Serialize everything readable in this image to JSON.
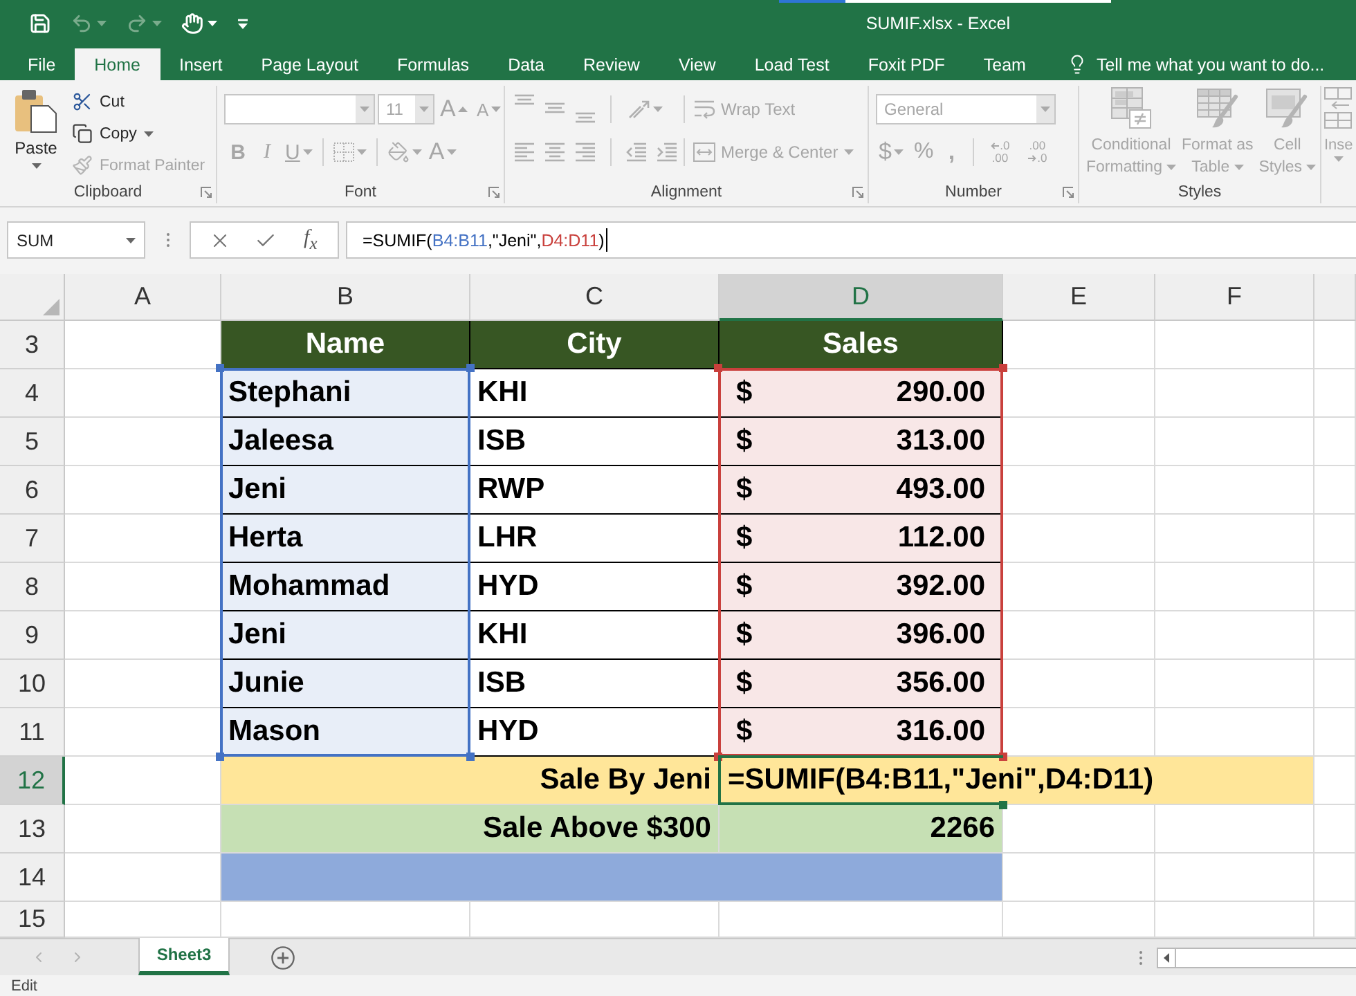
{
  "window": {
    "title": "SUMIF.xlsx - Excel",
    "progress": {
      "level": 0.2
    }
  },
  "quick_access": [
    {
      "kind": "save",
      "disabled": false
    },
    {
      "kind": "undo",
      "disabled": true
    },
    {
      "kind": "redo",
      "disabled": true
    },
    {
      "kind": "touch",
      "disabled": false
    },
    {
      "kind": "customize",
      "disabled": false
    }
  ],
  "ribbon_tabs": [
    {
      "label": "File",
      "selected": false
    },
    {
      "label": "Home",
      "selected": true
    },
    {
      "label": "Insert",
      "selected": false
    },
    {
      "label": "Page Layout",
      "selected": false
    },
    {
      "label": "Formulas",
      "selected": false
    },
    {
      "label": "Data",
      "selected": false
    },
    {
      "label": "Review",
      "selected": false
    },
    {
      "label": "View",
      "selected": false
    },
    {
      "label": "Load Test",
      "selected": false
    },
    {
      "label": "Foxit PDF",
      "selected": false
    },
    {
      "label": "Team",
      "selected": false
    }
  ],
  "tell_me": "Tell me what you want to do...",
  "ribbon": {
    "clipboard": {
      "label": "Clipboard",
      "paste": {
        "label": "Paste",
        "disabled": false
      },
      "items": [
        {
          "kind": "cut",
          "label": "Cut",
          "disabled": false
        },
        {
          "kind": "copy",
          "label": "Copy",
          "disabled": false
        },
        {
          "kind": "format_painter",
          "label": "Format Painter",
          "disabled": true
        }
      ]
    },
    "font": {
      "label": "Font",
      "disabled": true,
      "font_size": "11",
      "size_buttons": [
        {
          "kind": "grow",
          "label": "A"
        },
        {
          "kind": "shrink",
          "label": "A"
        }
      ],
      "style_buttons": [
        {
          "kind": "bold",
          "label": "B"
        },
        {
          "kind": "italic",
          "label": "I"
        },
        {
          "kind": "underline",
          "label": "U"
        }
      ],
      "font_color": "A"
    },
    "alignment": {
      "label": "Alignment",
      "disabled": true,
      "wrap_text": "Wrap Text",
      "merge_center": "Merge & Center"
    },
    "number": {
      "label": "Number",
      "disabled": true,
      "format": "General",
      "buttons": [
        {
          "kind": "currency",
          "label": "$"
        },
        {
          "kind": "percent",
          "label": "%"
        },
        {
          "kind": "comma",
          "label": ","
        }
      ],
      "decimals": [
        {
          "kind": "increase",
          "lines": [
            ".0",
            ".00"
          ]
        },
        {
          "kind": "decrease",
          "lines": [
            ".00",
            ".0"
          ]
        }
      ]
    },
    "styles": {
      "label": "Styles",
      "disabled": true,
      "buttons": [
        {
          "kind": "conditional",
          "lines": [
            "Conditional",
            "Formatting"
          ]
        },
        {
          "kind": "table",
          "lines": [
            "Format as",
            "Table"
          ]
        },
        {
          "kind": "cell_styles",
          "lines": [
            "Cell",
            "Styles"
          ]
        }
      ]
    },
    "cells": {
      "disabled": true,
      "insert": "Inse"
    }
  },
  "name_box": "SUM",
  "function_button": "f$_{x}$",
  "formula_bar": {
    "parts": [
      {
        "text": "=SUMIF(",
        "color": "#000000"
      },
      {
        "text": "B4:B11",
        "color": "#4472c4"
      },
      {
        "text": ",\"Jeni\",",
        "color": "#000000"
      },
      {
        "text": "D4:D11",
        "color": "#c9403c"
      },
      {
        "text": ")",
        "color": "#000000"
      }
    ]
  },
  "sheet": {
    "columns": [
      {
        "label": "A",
        "selected": false
      },
      {
        "label": "B",
        "selected": false
      },
      {
        "label": "C",
        "selected": false
      },
      {
        "label": "D",
        "selected": true
      },
      {
        "label": "E",
        "selected": false
      },
      {
        "label": "F",
        "selected": false
      }
    ],
    "reference_ranges": [
      {
        "kind": "name",
        "color": "#4472c4",
        "fill": {
          "color": "#e8eef8"
        }
      },
      {
        "kind": "amount",
        "color": "#c9403c",
        "fill": {
          "color": "#f8e7e7"
        }
      }
    ],
    "header_row": {
      "row": "3",
      "selected": false,
      "cells": [
        "Name",
        "City",
        "Sales"
      ]
    },
    "data_rows": [
      {
        "row": "4",
        "selected": false,
        "name": "Stephani",
        "city": "KHI",
        "currency": "$",
        "amount": "290.00"
      },
      {
        "row": "5",
        "selected": false,
        "name": "Jaleesa",
        "city": "ISB",
        "currency": "$",
        "amount": "313.00"
      },
      {
        "row": "6",
        "selected": false,
        "name": "Jeni",
        "city": "RWP",
        "currency": "$",
        "amount": "493.00"
      },
      {
        "row": "7",
        "selected": false,
        "name": "Herta",
        "city": "LHR",
        "currency": "$",
        "amount": "112.00"
      },
      {
        "row": "8",
        "selected": false,
        "name": "Mohammad",
        "city": "HYD",
        "currency": "$",
        "amount": "392.00"
      },
      {
        "row": "9",
        "selected": false,
        "name": "Jeni",
        "city": "KHI",
        "currency": "$",
        "amount": "396.00"
      },
      {
        "row": "10",
        "selected": false,
        "name": "Junie",
        "city": "ISB",
        "currency": "$",
        "amount": "356.00"
      },
      {
        "row": "11",
        "selected": false,
        "name": "Mason",
        "city": "HYD",
        "currency": "$",
        "amount": "316.00"
      }
    ],
    "summary_rows": [
      {
        "row": "12",
        "selected": true,
        "kind": "edit",
        "label": "Sale By Jeni",
        "value": "=SUMIF(B4:B11,\"Jeni\",D4:D11)",
        "color": "#ffe699"
      },
      {
        "row": "13",
        "selected": false,
        "kind": "result",
        "label": "Sale Above $300",
        "value": "2266",
        "color": "#c6e0b4"
      },
      {
        "row": "14",
        "selected": false,
        "kind": "blank",
        "color": "#8eaadb"
      }
    ],
    "trailing_rows": [
      {
        "row": "15",
        "selected": false
      }
    ]
  },
  "sheet_tabs": [
    {
      "label": "Sheet3",
      "selected": true
    }
  ],
  "status": "Edit"
}
